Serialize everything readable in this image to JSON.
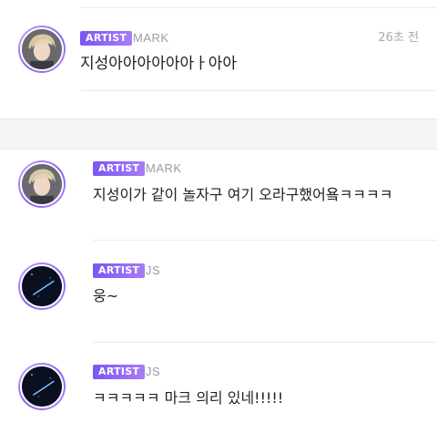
{
  "posts": [
    {
      "badge": "ARTIST",
      "name": "MARK",
      "time": "26초 전",
      "message": "지성아아아아아아ㅏ아아",
      "avatar": "mark-photo"
    },
    {
      "badge": "ARTIST",
      "name": "MARK",
      "message": "지성이가 같이 놀자구 여기 오라구했어욬ㅋㅋㅋㅋ",
      "avatar": "mark-photo"
    },
    {
      "badge": "ARTIST",
      "name": "JS",
      "message": "웅~",
      "avatar": "night-sky-streak"
    },
    {
      "badge": "ARTIST",
      "name": "JS",
      "message": "ㅋㅋㅋㅋㅋ 마크 의리 있네!!!!!",
      "avatar": "night-sky-streak"
    }
  ],
  "colors": {
    "badge_start": "#7b57f2",
    "badge_end": "#a77cf7",
    "avatar_ring": "#8a5cf0"
  }
}
